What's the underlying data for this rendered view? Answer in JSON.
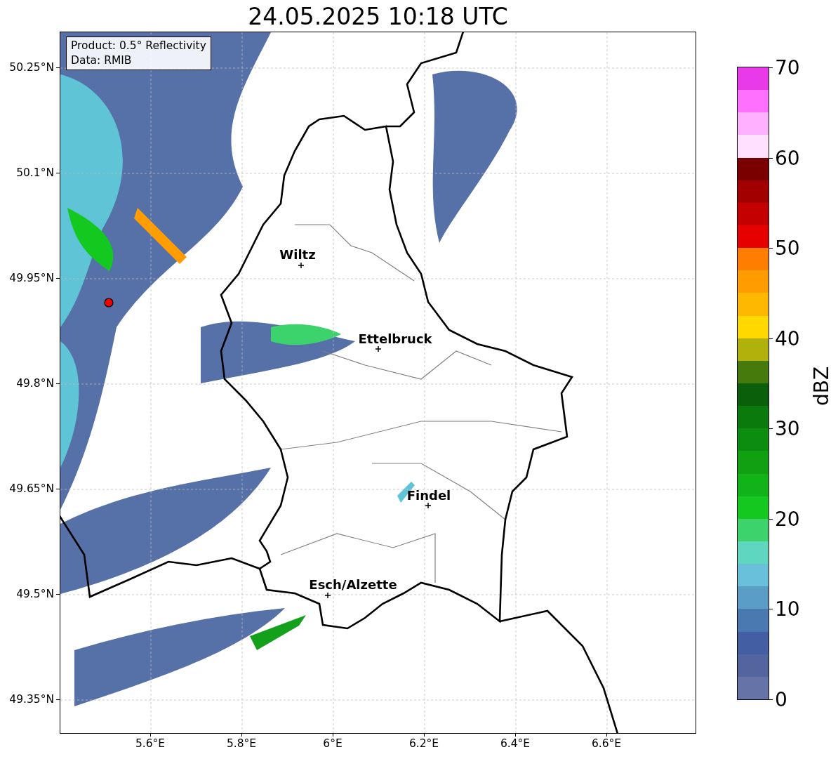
{
  "title": "24.05.2025 10:18 UTC",
  "info_box": [
    "Product: 0.5° Reflectivity",
    "Data: RMIB"
  ],
  "map": {
    "lat_ticks": [
      "50.25°N",
      "50.1°N",
      "49.95°N",
      "49.8°N",
      "49.65°N",
      "49.5°N",
      "49.35°N"
    ],
    "lon_ticks": [
      "5.6°E",
      "5.8°E",
      "6°E",
      "6.2°E",
      "6.4°E",
      "6.6°E"
    ],
    "places": [
      {
        "name": "Wiltz"
      },
      {
        "name": "Ettelbruck"
      },
      {
        "name": "Findel"
      },
      {
        "name": "Esch/Alzette"
      }
    ]
  },
  "colorbar": {
    "label": "dBZ",
    "ticks": [
      "70",
      "60",
      "50",
      "40",
      "30",
      "20",
      "10",
      "0"
    ],
    "bands": [
      {
        "color": "#6573a6"
      },
      {
        "color": "#52659e"
      },
      {
        "color": "#435ea2"
      },
      {
        "color": "#4a78b0"
      },
      {
        "color": "#5a9ec6"
      },
      {
        "color": "#68c0da"
      },
      {
        "color": "#5fd7c0"
      },
      {
        "color": "#3dd36c"
      },
      {
        "color": "#13c81f"
      },
      {
        "color": "#11b319"
      },
      {
        "color": "#11a012"
      },
      {
        "color": "#0d8d10"
      },
      {
        "color": "#0b7a0d"
      },
      {
        "color": "#0a5f0b"
      },
      {
        "color": "#477a0c"
      },
      {
        "color": "#b0b10a"
      },
      {
        "color": "#ffd800"
      },
      {
        "color": "#ffb800"
      },
      {
        "color": "#ff9c00"
      },
      {
        "color": "#ff7e00"
      },
      {
        "color": "#e60000"
      },
      {
        "color": "#c40000"
      },
      {
        "color": "#a20000"
      },
      {
        "color": "#7a0000"
      },
      {
        "color": "#ffe0ff"
      },
      {
        "color": "#ffb0ff"
      },
      {
        "color": "#ff70ff"
      },
      {
        "color": "#e83ae8"
      }
    ]
  }
}
